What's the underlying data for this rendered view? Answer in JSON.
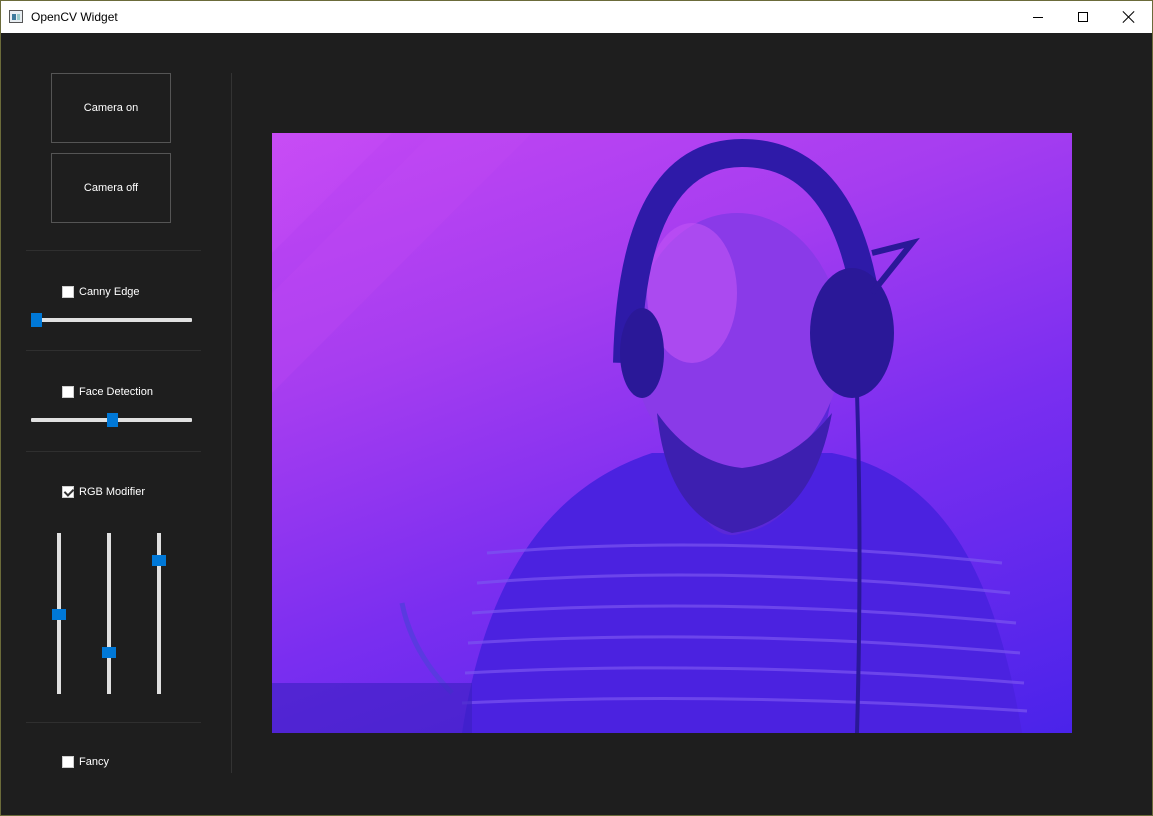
{
  "window": {
    "title": "OpenCV Widget"
  },
  "controls": {
    "camera_on_label": "Camera on",
    "camera_off_label": "Camera off",
    "canny": {
      "label": "Canny Edge",
      "checked": false,
      "slider_value": 0.03
    },
    "face": {
      "label": "Face Detection",
      "checked": false,
      "slider_value": 0.5
    },
    "rgb": {
      "label": "RGB Modifier",
      "checked": true,
      "sliders": [
        0.5,
        0.74,
        0.17
      ]
    },
    "fancy": {
      "label": "Fancy",
      "checked": false
    }
  },
  "colors": {
    "accent": "#0078d7",
    "background": "#1e1e1e"
  }
}
